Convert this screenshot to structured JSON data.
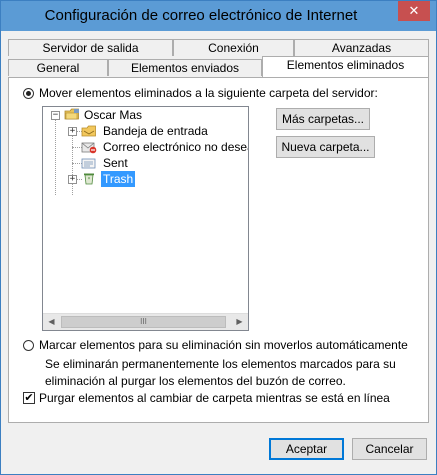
{
  "window": {
    "title": "Configuración de correo electrónico de Internet",
    "close_glyph": "✕"
  },
  "tabs": {
    "back_row": [
      "Servidor de salida",
      "Conexión",
      "Avanzadas"
    ],
    "front_row": [
      "General",
      "Elementos enviados",
      "Elementos eliminados"
    ],
    "active": "Elementos eliminados"
  },
  "options": {
    "move_label": "Mover elementos eliminados a la siguiente carpeta del servidor:",
    "mark_label": "Marcar elementos para su eliminación sin moverlos automáticamente",
    "mark_note": "Se eliminarán permanentemente los elementos marcados para su eliminación al purgar los elementos del buzón de correo.",
    "purge_label": "Purgar elementos al cambiar de carpeta mientras se está en línea",
    "purge_checked": true,
    "selected": "move"
  },
  "tree": {
    "root": {
      "label": "Oscar Mas",
      "icon": "account-folder-icon",
      "expander": "−"
    },
    "children": [
      {
        "label": "Bandeja de entrada",
        "icon": "inbox-folder-icon",
        "expander": "+"
      },
      {
        "label": "Correo electrónico no deseado",
        "icon": "junk-folder-icon",
        "expander": ""
      },
      {
        "label": "Sent",
        "icon": "sent-folder-icon",
        "expander": ""
      },
      {
        "label": "Trash",
        "icon": "trash-folder-icon",
        "expander": "+",
        "selected": true
      }
    ],
    "scroll_grip": "III"
  },
  "buttons": {
    "more_folders": "Más carpetas...",
    "new_folder": "Nueva carpeta...",
    "ok": "Aceptar",
    "cancel": "Cancelar"
  },
  "colors": {
    "titlebar": "#5b9bd5",
    "close": "#c75050",
    "selection": "#3399ff",
    "default_button_border": "#0078d7"
  }
}
